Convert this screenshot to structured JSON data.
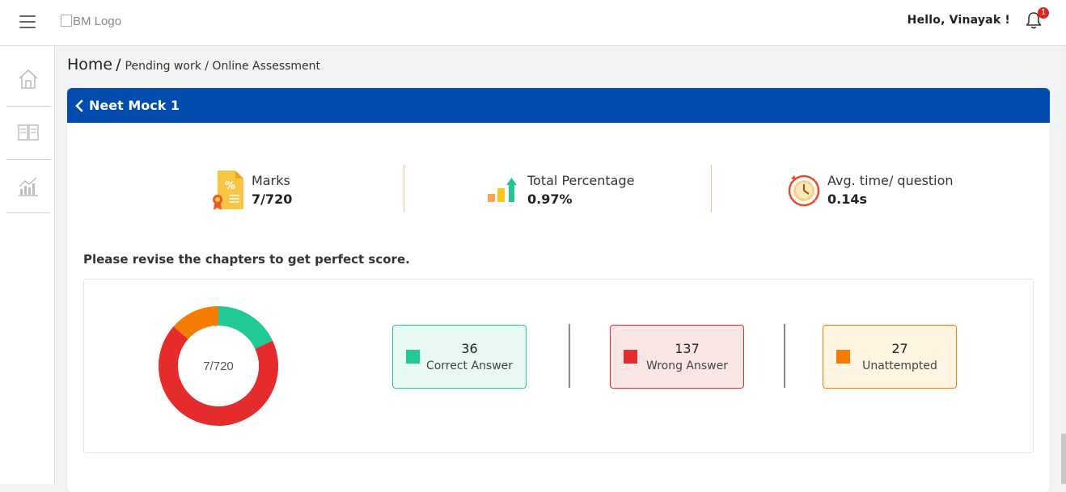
{
  "header": {
    "logo_alt": "BM Logo",
    "greeting": "Hello, Vinayak !",
    "notification_count": "1"
  },
  "sidebar": {
    "items": [
      {
        "icon": "home-icon"
      },
      {
        "icon": "book-icon"
      },
      {
        "icon": "analytics-icon"
      }
    ]
  },
  "breadcrumb": {
    "home": "Home",
    "separator": "/",
    "rest": "Pending work / Online Assessment"
  },
  "assessment": {
    "title": "Neet Mock 1",
    "stats": [
      {
        "label": "Marks",
        "value": "7/720",
        "icon": "marks-certificate-icon"
      },
      {
        "label": "Total Percentage",
        "value": "0.97%",
        "icon": "percentage-growth-icon"
      },
      {
        "label": "Avg. time/ question",
        "value": "0.14s",
        "icon": "stopwatch-icon"
      }
    ],
    "revise_message": "Please revise the chapters to get perfect score."
  },
  "chart_data": {
    "type": "pie",
    "center_label": "7/720",
    "series": [
      {
        "name": "Correct Answer",
        "value": 36,
        "color": "#22c997"
      },
      {
        "name": "Wrong Answer",
        "value": 137,
        "color": "#e42c2c"
      },
      {
        "name": "Unattempted",
        "value": 27,
        "color": "#f57c00"
      }
    ]
  },
  "legend": [
    {
      "count": "36",
      "label": "Correct Answer",
      "color": "#22c997",
      "bg": "#e8f9f4",
      "border": "#22c997"
    },
    {
      "count": "137",
      "label": "Wrong Answer",
      "color": "#e42c2c",
      "bg": "#fbe6e6",
      "border": "#e42c2c"
    },
    {
      "count": "27",
      "label": "Unattempted",
      "color": "#f57c00",
      "bg": "#fdf5e1",
      "border": "#f57c00"
    }
  ]
}
